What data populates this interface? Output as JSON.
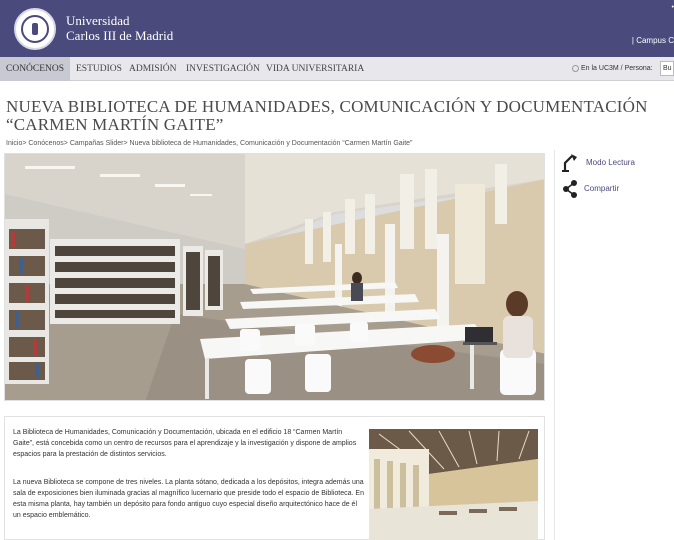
{
  "header": {
    "university_line1": "Universidad",
    "university_line2": "Carlos III de Madrid",
    "campus_link": "| Campus C",
    "corner_mark": "•"
  },
  "nav": {
    "items": [
      {
        "label": "CONÓCENOS",
        "active": true
      },
      {
        "label": "ESTUDIOS"
      },
      {
        "label": "ADMISIÓN"
      },
      {
        "label": "INVESTIGACIÓN"
      },
      {
        "label": "VIDA UNIVERSITARIA"
      }
    ],
    "search_label": "En la UC3M / Persona:",
    "search_value": "Bu"
  },
  "page": {
    "title": "NUEVA BIBLIOTECA DE HUMANIDADES, COMUNICACIÓN Y DOCUMENTACIÓN “CARMEN MARTÍN GAITE”",
    "breadcrumb": "Inicio> Conócenos> Campañas Slider> Nueva biblioteca de Humanidades, Comunicación y Documentación “Carmen Martín Gaite”"
  },
  "tools": {
    "reading_mode": "Modo Lectura",
    "share": "Compartir"
  },
  "content": {
    "paragraph1": "La Biblioteca de Humanidades, Comunicación y Documentación, ubicada en el edificio 18 “Carmen Martín Gaite”, está concebida como un centro de recursos para el aprendizaje y la investigación y dispone de amplios espacios para la prestación de distintos servicios.",
    "paragraph2": "La nueva Biblioteca se compone de tres niveles. La planta sótano, dedicada a los depósitos, integra además una sala de exposiciones bien iluminada gracias al magnífico lucernario que preside todo el espacio de Biblioteca. En esta misma planta, hay también un depósito para fondo antiguo cuyo especial diseño arquitectónico hace de él un espacio emblemático."
  },
  "colors": {
    "header_bg": "#4a4a7c",
    "nav_bg": "#e8e8ec",
    "accent": "#4a4a7c"
  },
  "icons": {
    "reading_mode": "reading-lamp-icon",
    "share": "share-icon"
  }
}
